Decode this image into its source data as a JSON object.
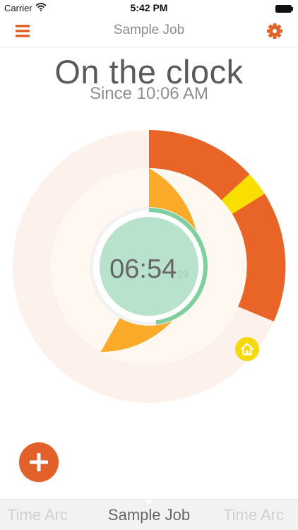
{
  "status_bar": {
    "carrier": "Carrier",
    "time": "5:42 PM"
  },
  "nav": {
    "title": "Sample Job",
    "menu_icon": "hamburger-menu-icon",
    "settings_icon": "gear-icon"
  },
  "main": {
    "headline": "On the clock",
    "subline": "Since 10:06 AM",
    "timer": {
      "main": "06:54",
      "seconds": "29"
    },
    "home_icon": "home-icon",
    "add_icon": "plus-icon"
  },
  "pager": {
    "prev": "Time Arc",
    "current": "Sample Job",
    "next": "Time Arc"
  },
  "colors": {
    "accent_orange": "#e2602a",
    "work_amber": "#fbab29",
    "highlight_yellow": "#f8df00",
    "timer_mint": "#b8e2cc",
    "timer_progress": "#7fcf9f",
    "outer_track": "#fdf1ec",
    "inner_track": "#fff8f0"
  }
}
